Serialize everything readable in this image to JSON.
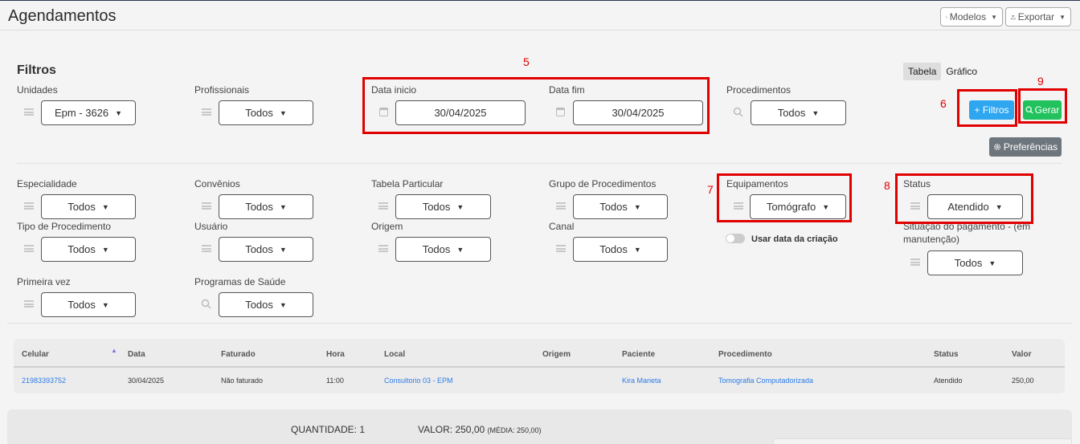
{
  "page": {
    "title": "Agendamentos"
  },
  "header": {
    "modelos_label": "Modelos",
    "exportar_label": "Exportar"
  },
  "filters": {
    "title": "Filtros",
    "unidades": {
      "label": "Unidades",
      "value": "Epm - 3626"
    },
    "profissionais": {
      "label": "Profissionais",
      "value": "Todos"
    },
    "data_inicio": {
      "label": "Data inicio",
      "value": "30/04/2025"
    },
    "data_fim": {
      "label": "Data fim",
      "value": "30/04/2025"
    },
    "procedimentos": {
      "label": "Procedimentos",
      "value": "Todos"
    },
    "especialidade": {
      "label": "Especialidade",
      "value": "Todos"
    },
    "convenios": {
      "label": "Convênios",
      "value": "Todos"
    },
    "tabela_particular": {
      "label": "Tabela Particular",
      "value": "Todos"
    },
    "grupo_procedimentos": {
      "label": "Grupo de Procedimentos",
      "value": "Todos"
    },
    "equipamentos": {
      "label": "Equipamentos",
      "value": "Tomógrafo"
    },
    "status": {
      "label": "Status",
      "value": "Atendido"
    },
    "tipo_procedimento": {
      "label": "Tipo de Procedimento",
      "value": "Todos"
    },
    "usuario": {
      "label": "Usuário",
      "value": "Todos"
    },
    "origem": {
      "label": "Origem",
      "value": "Todos"
    },
    "canal": {
      "label": "Canal",
      "value": "Todos"
    },
    "situacao_pagamento": {
      "label_line1": "Situação do pagamento - (em",
      "label_line2": "manutenção)",
      "value": "Todos"
    },
    "primeira_vez": {
      "label": "Primeira vez",
      "value": "Todos"
    },
    "programas_saude": {
      "label": "Programas de Saúde",
      "value": "Todos"
    },
    "usar_data_criacao": {
      "label": "Usar data da criação",
      "checked": false
    }
  },
  "view_tabs": [
    {
      "label": "Tabela",
      "active": true
    },
    {
      "label": "Gráfico",
      "active": false
    }
  ],
  "actions": {
    "filtros_label": "+ Filtros",
    "gerar_label": "Gerar",
    "preferencias_label": "Preferências"
  },
  "annotations": {
    "n5": "5",
    "n6": "6",
    "n7": "7",
    "n8": "8",
    "n9": "9",
    "color": "#e00000"
  },
  "table": {
    "columns": [
      "Celular",
      "Data",
      "Faturado",
      "Hora",
      "Local",
      "Origem",
      "Paciente",
      "Procedimento",
      "Status",
      "Valor"
    ],
    "rows": [
      {
        "celular": "21983393752",
        "data": "30/04/2025",
        "faturado": "Não faturado",
        "hora": "11:00",
        "local": "Consultorio 03 - EPM",
        "origem": "",
        "paciente": "Kira Marieta",
        "procedimento": "Tomografia Computadorizada",
        "status": "Atendido",
        "valor": "250,00"
      }
    ]
  },
  "summary": {
    "quantidade": "QUANTIDADE: 1",
    "valor": "VALOR: 250,00",
    "media": "(MÉDIA: 250,00)"
  },
  "colors": {
    "primary": "#2ea6f0",
    "success": "#21c25e",
    "secondary": "#6e767d",
    "link": "#2c7be5"
  }
}
